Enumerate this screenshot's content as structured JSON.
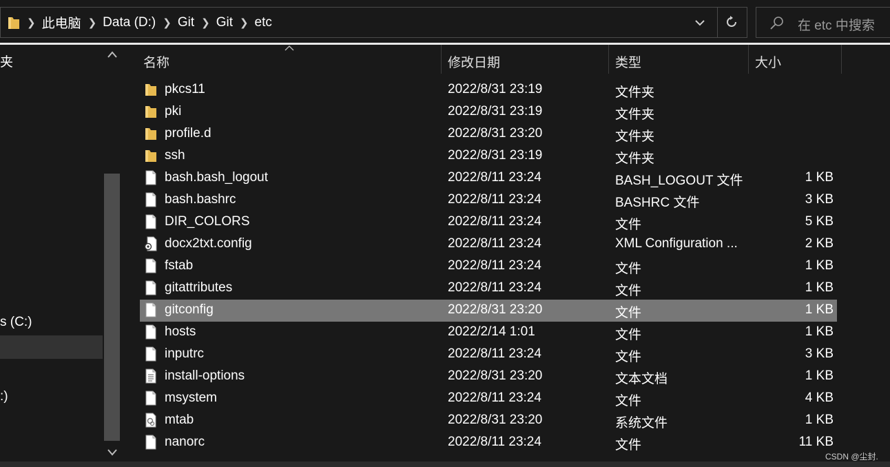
{
  "address_bar": {
    "breadcrumbs": [
      "此电脑",
      "Data (D:)",
      "Git",
      "Git",
      "etc"
    ]
  },
  "search": {
    "placeholder": "在 etc 中搜索"
  },
  "nav_pane": {
    "texts": [
      {
        "label": "夹"
      },
      {
        "label": "s (C:)"
      },
      {
        "label": ":)"
      }
    ]
  },
  "columns": {
    "name": "名称",
    "date": "修改日期",
    "type": "类型",
    "size": "大小"
  },
  "files": [
    {
      "name": "pkcs11",
      "date": "2022/8/31 23:19",
      "type": "文件夹",
      "size": "",
      "icon": "folder-icon"
    },
    {
      "name": "pki",
      "date": "2022/8/31 23:19",
      "type": "文件夹",
      "size": "",
      "icon": "folder-icon"
    },
    {
      "name": "profile.d",
      "date": "2022/8/31 23:20",
      "type": "文件夹",
      "size": "",
      "icon": "folder-icon"
    },
    {
      "name": "ssh",
      "date": "2022/8/31 23:19",
      "type": "文件夹",
      "size": "",
      "icon": "folder-icon"
    },
    {
      "name": "bash.bash_logout",
      "date": "2022/8/11 23:24",
      "type": "BASH_LOGOUT 文件",
      "size": "1 KB",
      "icon": "file-icon"
    },
    {
      "name": "bash.bashrc",
      "date": "2022/8/11 23:24",
      "type": "BASHRC 文件",
      "size": "3 KB",
      "icon": "file-icon"
    },
    {
      "name": "DIR_COLORS",
      "date": "2022/8/11 23:24",
      "type": "文件",
      "size": "5 KB",
      "icon": "file-icon"
    },
    {
      "name": "docx2txt.config",
      "date": "2022/8/11 23:24",
      "type": "XML Configuration ...",
      "size": "2 KB",
      "icon": "config-file-icon"
    },
    {
      "name": "fstab",
      "date": "2022/8/11 23:24",
      "type": "文件",
      "size": "1 KB",
      "icon": "file-icon"
    },
    {
      "name": "gitattributes",
      "date": "2022/8/11 23:24",
      "type": "文件",
      "size": "1 KB",
      "icon": "file-icon"
    },
    {
      "name": "gitconfig",
      "date": "2022/8/31 23:20",
      "type": "文件",
      "size": "1 KB",
      "icon": "file-icon",
      "selected": true
    },
    {
      "name": "hosts",
      "date": "2022/2/14 1:01",
      "type": "文件",
      "size": "1 KB",
      "icon": "file-icon"
    },
    {
      "name": "inputrc",
      "date": "2022/8/11 23:24",
      "type": "文件",
      "size": "3 KB",
      "icon": "file-icon"
    },
    {
      "name": "install-options",
      "date": "2022/8/31 23:20",
      "type": "文本文档",
      "size": "1 KB",
      "icon": "text-file-icon"
    },
    {
      "name": "msystem",
      "date": "2022/8/11 23:24",
      "type": "文件",
      "size": "4 KB",
      "icon": "file-icon"
    },
    {
      "name": "mtab",
      "date": "2022/8/31 23:20",
      "type": "系统文件",
      "size": "1 KB",
      "icon": "system-file-icon"
    },
    {
      "name": "nanorc",
      "date": "2022/8/11 23:24",
      "type": "文件",
      "size": "11 KB",
      "icon": "file-icon"
    }
  ],
  "watermark": "CSDN @尘封."
}
